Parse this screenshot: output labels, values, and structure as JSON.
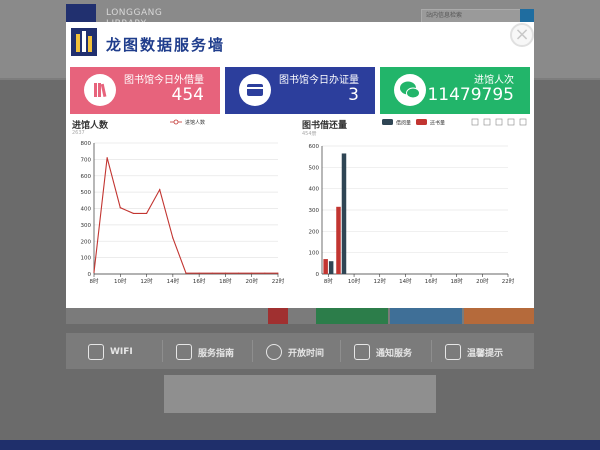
{
  "background": {
    "logo_line1": "LONGGANG",
    "logo_line2": "LIBRARY",
    "search_placeholder": "站内信息检索",
    "bar_items": [
      {
        "icon": "wifi-icon",
        "label": "WIFI"
      },
      {
        "icon": "guide-icon",
        "label": "服务指南"
      },
      {
        "icon": "clock-icon",
        "label": "开放时间"
      },
      {
        "icon": "chat-icon",
        "label": "通知服务"
      },
      {
        "icon": "eye-icon",
        "label": "温馨提示"
      }
    ]
  },
  "modal": {
    "title": "龙图数据服务墙",
    "close_label": "×",
    "stats": [
      {
        "label": "图书馆今日外借量",
        "value": "454",
        "color": "#e7637c",
        "icon": "books-icon"
      },
      {
        "label": "图书馆今日办证量",
        "value": "3",
        "color": "#2c3e9c",
        "icon": "card-icon"
      },
      {
        "label": "进馆人次",
        "value": "11479795",
        "color": "#22b56a",
        "icon": "wechat-icon"
      }
    ]
  },
  "chart_data": [
    {
      "type": "line",
      "title": "进馆人数",
      "subtitle": "2637",
      "legend": [
        "进馆人数"
      ],
      "series": [
        {
          "name": "进馆人数",
          "color": "#c23531",
          "x": [
            8,
            9,
            10,
            11,
            12,
            13,
            14,
            15,
            16,
            17,
            18,
            19,
            20,
            21,
            22
          ],
          "values": [
            10,
            710,
            405,
            370,
            370,
            515,
            220,
            5,
            5,
            5,
            5,
            5,
            5,
            5,
            5
          ]
        }
      ],
      "x_ticks": [
        "8时",
        "10时",
        "12时",
        "14时",
        "16时",
        "18时",
        "20时",
        "22时"
      ],
      "x_range": [
        8,
        22
      ],
      "y_ticks": [
        "0",
        "100",
        "200",
        "300",
        "400",
        "500",
        "600",
        "700",
        "800"
      ],
      "ylim": [
        0,
        800
      ]
    },
    {
      "type": "bar",
      "title": "图书借还量",
      "subtitle": "454册",
      "legend": [
        {
          "name": "借阅量",
          "color": "#2f4554"
        },
        {
          "name": "还书量",
          "color": "#c23531"
        }
      ],
      "series": [
        {
          "name": "借阅量",
          "color": "#2f4554",
          "x": [
            8,
            9
          ],
          "values": [
            60,
            565
          ]
        },
        {
          "name": "还书量",
          "color": "#c23531",
          "x": [
            8,
            9
          ],
          "values": [
            70,
            315
          ]
        }
      ],
      "x_ticks": [
        "8时",
        "10时",
        "12时",
        "14时",
        "16时",
        "18时",
        "20时",
        "22时"
      ],
      "x_range": [
        7.5,
        22
      ],
      "y_ticks": [
        "0",
        "100",
        "200",
        "300",
        "400",
        "500",
        "600"
      ],
      "ylim": [
        0,
        600
      ],
      "toolbox": [
        "data-view-icon",
        "line-icon",
        "bar-icon",
        "refresh-icon",
        "download-icon"
      ]
    }
  ]
}
